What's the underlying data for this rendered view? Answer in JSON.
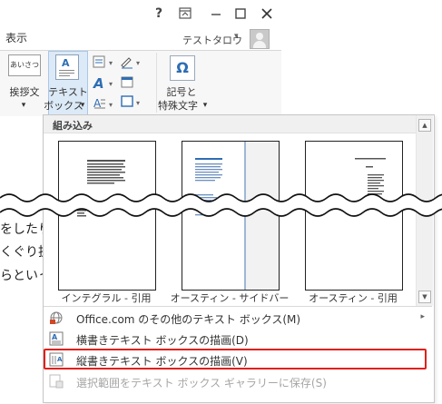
{
  "titlebar": {
    "help_label": "?",
    "restore_ribbon_label": "⊼",
    "minimize_label": "—",
    "maximize_label": "□",
    "close_label": "✕"
  },
  "ribbon": {
    "tab_view": "表示",
    "user_name": "テストタロウ",
    "user_menu_arrow": "▾",
    "greeting_btn": {
      "line1": "挨拶文",
      "arrow": "▾"
    },
    "textbox_btn": {
      "line1": "テキスト",
      "line2": "ボックス",
      "arrow": "▾"
    },
    "symbol_btn": {
      "line1": "記号と",
      "line2": "特殊文字",
      "arrow": "▾"
    },
    "greeting_icon_text": "あいさつ",
    "symbol_icon_glyph": "Ω",
    "wordart_icon_glyph": "A"
  },
  "document": {
    "lines": [
      "をしたり",
      "くぐり抜",
      "らといっ"
    ]
  },
  "gallery": {
    "header": "組み込み",
    "items": [
      {
        "caption": "インテグラル - 引用"
      },
      {
        "caption": "オースティン - サイドバー"
      },
      {
        "caption": "オースティン - 引用"
      }
    ],
    "scroll_up": "▲",
    "scroll_down": "▼"
  },
  "menu": {
    "items": [
      {
        "label": "Office.com のその他のテキスト ボックス(M)",
        "has_submenu": true,
        "enabled": true,
        "submenu_arrow": "▸"
      },
      {
        "label": "横書きテキスト ボックスの描画(D)",
        "enabled": true
      },
      {
        "label": "縦書きテキスト ボックスの描画(V)",
        "enabled": true,
        "highlighted": true
      },
      {
        "label": "選択範囲をテキスト ボックス ギャラリーに保存(S)",
        "enabled": false
      }
    ]
  },
  "colors": {
    "highlight": "#e0201b",
    "selected_button": "#dce9f7",
    "accent_blue": "#2e6db4"
  }
}
